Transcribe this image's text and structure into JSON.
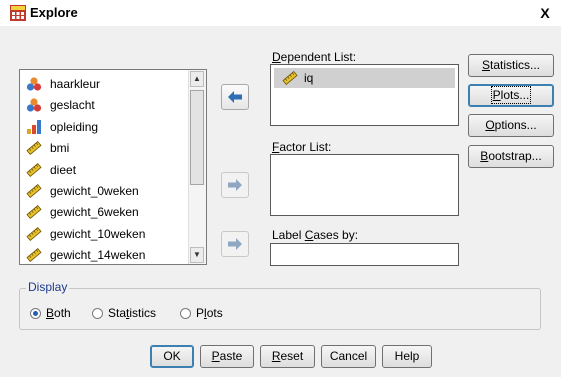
{
  "window": {
    "title": "Explore",
    "close_label": "X"
  },
  "variables": [
    {
      "name": "haarkleur",
      "icon": "nominal-variable-icon"
    },
    {
      "name": "geslacht",
      "icon": "nominal-variable-icon"
    },
    {
      "name": "opleiding",
      "icon": "ordinal-variable-icon"
    },
    {
      "name": "bmi",
      "icon": "scale-variable-icon"
    },
    {
      "name": "dieet",
      "icon": "scale-variable-icon"
    },
    {
      "name": "gewicht_0weken",
      "icon": "scale-variable-icon"
    },
    {
      "name": "gewicht_6weken",
      "icon": "scale-variable-icon"
    },
    {
      "name": "gewicht_10weken",
      "icon": "scale-variable-icon"
    },
    {
      "name": "gewicht_14weken",
      "icon": "scale-variable-icon"
    }
  ],
  "dependent": {
    "label_pre": "",
    "label_u": "D",
    "label_post": "ependent List:",
    "items": [
      "iq"
    ]
  },
  "factor": {
    "label_pre": "",
    "label_u": "F",
    "label_post": "actor List:"
  },
  "label_cases": {
    "label_pre": "Label ",
    "label_u": "C",
    "label_post": "ases by:"
  },
  "side_buttons": {
    "statistics": {
      "pre": "",
      "u": "S",
      "post": "tatistics..."
    },
    "plots": {
      "pre": "",
      "u": "P",
      "post": "lots..."
    },
    "options": {
      "pre": "",
      "u": "O",
      "post": "ptions..."
    },
    "bootstrap": {
      "pre": "",
      "u": "B",
      "post": "ootstrap..."
    }
  },
  "display": {
    "title": "Display",
    "both": {
      "pre": "",
      "u": "B",
      "post": "oth"
    },
    "statistics": {
      "pre": "Sta",
      "u": "t",
      "post": "istics"
    },
    "plots": {
      "pre": "P",
      "u": "l",
      "post": "ots"
    },
    "selected": "both"
  },
  "buttons": {
    "ok": "OK",
    "paste": {
      "pre": "",
      "u": "P",
      "post": "aste"
    },
    "reset": {
      "pre": "",
      "u": "R",
      "post": "eset"
    },
    "cancel": "Cancel",
    "help": "Help"
  },
  "colors": {
    "accent": "#3c7fb1",
    "selection": "#d0d0d0",
    "group_title": "#1e3c8c"
  }
}
